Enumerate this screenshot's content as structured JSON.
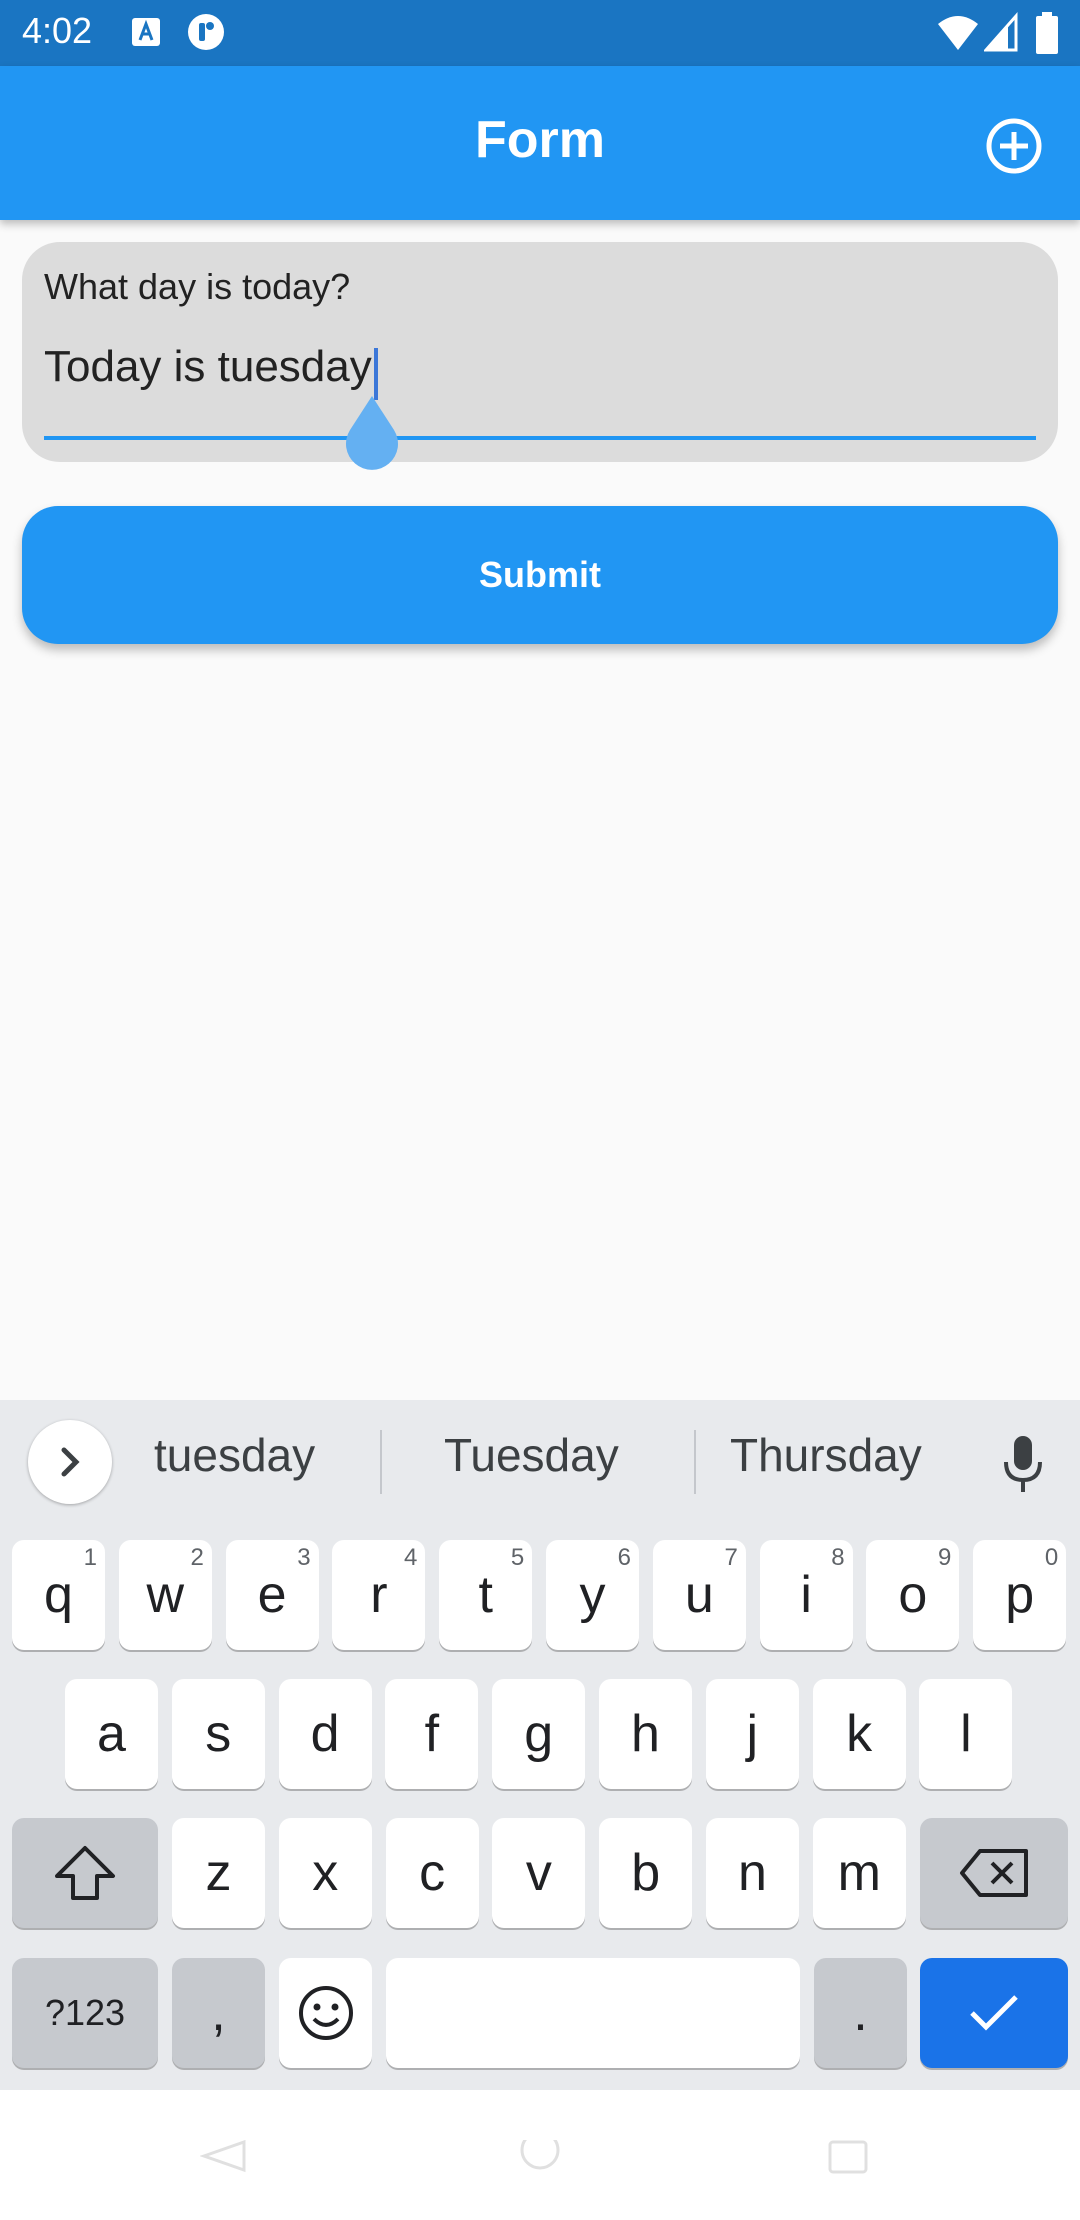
{
  "status_bar": {
    "time": "4:02"
  },
  "app_bar": {
    "title": "Form"
  },
  "form": {
    "field_label": "What day is today?",
    "field_value": "Today is tuesday",
    "submit_label": "Submit"
  },
  "keyboard": {
    "suggestions": [
      "tuesday",
      "Tuesday",
      "Thursday"
    ],
    "row1": [
      {
        "k": "q",
        "h": "1"
      },
      {
        "k": "w",
        "h": "2"
      },
      {
        "k": "e",
        "h": "3"
      },
      {
        "k": "r",
        "h": "4"
      },
      {
        "k": "t",
        "h": "5"
      },
      {
        "k": "y",
        "h": "6"
      },
      {
        "k": "u",
        "h": "7"
      },
      {
        "k": "i",
        "h": "8"
      },
      {
        "k": "o",
        "h": "9"
      },
      {
        "k": "p",
        "h": "0"
      }
    ],
    "row2": [
      "a",
      "s",
      "d",
      "f",
      "g",
      "h",
      "j",
      "k",
      "l"
    ],
    "row3": [
      "z",
      "x",
      "c",
      "v",
      "b",
      "n",
      "m"
    ],
    "symbols_label": "?123",
    "comma": ",",
    "period": "."
  },
  "colors": {
    "app_bar": "#2196f3",
    "status_bar": "#1a75c2",
    "enter_key": "#1a73e8"
  }
}
